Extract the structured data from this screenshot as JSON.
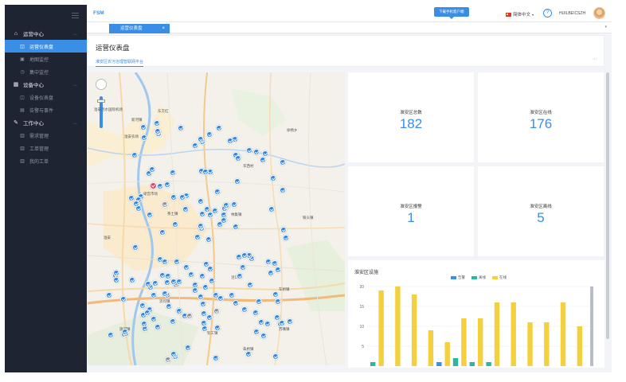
{
  "header": {
    "brand": "FSM",
    "download_label": "下载手机客户端",
    "language": "简体中文",
    "user": "HUILBE\\CSZH"
  },
  "sidebar": {
    "groups": [
      {
        "label": "运营中心",
        "icon": "home-icon",
        "items": [
          {
            "label": "运营仪表盘",
            "icon": "dashboard-icon",
            "active": true
          },
          {
            "label": "地图监控",
            "icon": "map-icon"
          },
          {
            "label": "集中监控",
            "icon": "clock-icon"
          }
        ]
      },
      {
        "label": "设备中心",
        "icon": "grid-icon",
        "items": [
          {
            "label": "设备仪表盘",
            "icon": "dashboard-icon"
          },
          {
            "label": "告警与事件",
            "icon": "alarm-icon"
          }
        ]
      },
      {
        "label": "工作中心",
        "icon": "wrench-icon",
        "items": [
          {
            "label": "需求管理",
            "icon": "doc-icon"
          },
          {
            "label": "工单管理",
            "icon": "doc-icon"
          },
          {
            "label": "我的工单",
            "icon": "doc-icon"
          }
        ]
      }
    ]
  },
  "tabs": {
    "active": "运营仪表盘"
  },
  "page": {
    "title": "运营仪表盘",
    "subtab": "淮安区农污治理智联网平台"
  },
  "map": {
    "labels": [
      "淮安涟水国际机场",
      "东方红",
      "新河镇",
      "徐杨乡",
      "淮安农场",
      "淮安",
      "林集镇",
      "茶土镇",
      "铁头镇",
      "华西村",
      "梁宫市场",
      "泾口镇",
      "车桥镇",
      "流均镇",
      "苏嘴镇",
      "钦工镇",
      "施河镇",
      "朱桥镇"
    ]
  },
  "stats": [
    {
      "label": "淮安区总数",
      "value": "182"
    },
    {
      "label": "淮安区在线",
      "value": "176"
    },
    {
      "label": "淮安区报警",
      "value": "1"
    },
    {
      "label": "淮安区离线",
      "value": "5"
    }
  ],
  "chart_data": {
    "type": "bar",
    "title": "淮安区设施",
    "legend_position": "top-center",
    "ylim": [
      0,
      20
    ],
    "yticks": [
      5,
      10,
      15,
      20
    ],
    "grid": true,
    "series": [
      {
        "name": "告警",
        "color": "#3a8ee6",
        "values": [
          0,
          0,
          0,
          0,
          0,
          0,
          0,
          0,
          1,
          0,
          0,
          0,
          0,
          0,
          0,
          0,
          0,
          0,
          0,
          0,
          0,
          0,
          0,
          0,
          0,
          0
        ]
      },
      {
        "name": "离线",
        "color": "#2bb6a0",
        "values": [
          1,
          0,
          0,
          0,
          0,
          0,
          0,
          0,
          0,
          0,
          2,
          0,
          1,
          0,
          1,
          0,
          0,
          0,
          0,
          0,
          0,
          0,
          0,
          0,
          0,
          0
        ]
      },
      {
        "name": "在线",
        "color": "#f4d03f",
        "values": [
          0,
          19,
          0,
          20,
          0,
          18,
          0,
          9,
          0,
          6,
          0,
          12,
          0,
          12,
          0,
          16,
          0,
          16,
          0,
          11,
          0,
          11,
          0,
          16,
          0,
          10
        ]
      }
    ],
    "extra_bar": {
      "color": "#b8bdc6",
      "value": 20
    }
  }
}
